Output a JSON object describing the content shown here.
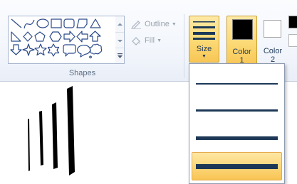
{
  "ribbon": {
    "shapes_group": {
      "label": "Shapes",
      "outline_label": "Outline",
      "fill_label": "Fill",
      "shapes": [
        "line",
        "curve",
        "oval",
        "rectangle",
        "rounded-rectangle",
        "polygon",
        "triangle",
        "right-triangle",
        "diamond",
        "pentagon",
        "hexagon",
        "right-arrow",
        "left-arrow",
        "up-arrow",
        "down-arrow",
        "four-point-star",
        "five-point-star",
        "six-point-star",
        "rounded-callout",
        "oval-callout",
        "cloud-callout"
      ]
    },
    "size_button": {
      "label": "Size"
    },
    "color1": {
      "label_line1": "Color",
      "label_line2": "1",
      "color": "#000000"
    },
    "color2": {
      "label_line1": "Color",
      "label_line2": "2",
      "color": "#ffffff"
    }
  },
  "size_dropdown": {
    "options": [
      "1px",
      "3px",
      "5px",
      "8px"
    ],
    "selected_index": 3
  },
  "colors": {
    "highlight": "#fbd975",
    "line": "#1d3857"
  }
}
